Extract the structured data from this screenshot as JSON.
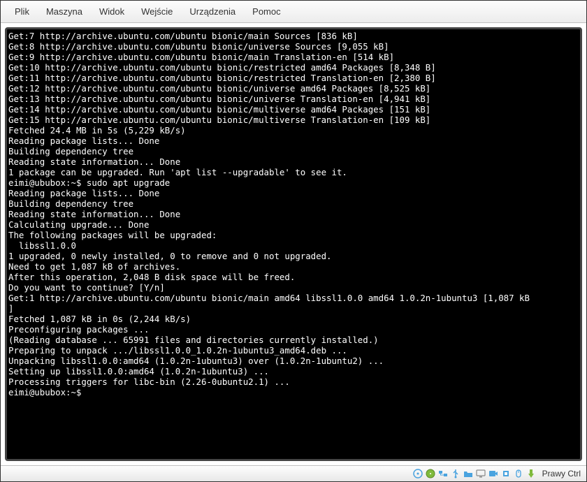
{
  "menubar": {
    "items": [
      "Plik",
      "Maszyna",
      "Widok",
      "Wejście",
      "Urządzenia",
      "Pomoc"
    ]
  },
  "terminal": {
    "lines": [
      "Get:7 http://archive.ubuntu.com/ubuntu bionic/main Sources [836 kB]",
      "Get:8 http://archive.ubuntu.com/ubuntu bionic/universe Sources [9,055 kB]",
      "Get:9 http://archive.ubuntu.com/ubuntu bionic/main Translation-en [514 kB]",
      "Get:10 http://archive.ubuntu.com/ubuntu bionic/restricted amd64 Packages [8,348 B]",
      "Get:11 http://archive.ubuntu.com/ubuntu bionic/restricted Translation-en [2,380 B]",
      "Get:12 http://archive.ubuntu.com/ubuntu bionic/universe amd64 Packages [8,525 kB]",
      "Get:13 http://archive.ubuntu.com/ubuntu bionic/universe Translation-en [4,941 kB]",
      "Get:14 http://archive.ubuntu.com/ubuntu bionic/multiverse amd64 Packages [151 kB]",
      "Get:15 http://archive.ubuntu.com/ubuntu bionic/multiverse Translation-en [109 kB]",
      "Fetched 24.4 MB in 5s (5,229 kB/s)",
      "Reading package lists... Done",
      "Building dependency tree",
      "Reading state information... Done",
      "1 package can be upgraded. Run 'apt list --upgradable' to see it.",
      "eimi@ububox:~$ sudo apt upgrade",
      "Reading package lists... Done",
      "Building dependency tree",
      "Reading state information... Done",
      "Calculating upgrade... Done",
      "The following packages will be upgraded:",
      "  libssl1.0.0",
      "1 upgraded, 0 newly installed, 0 to remove and 0 not upgraded.",
      "Need to get 1,087 kB of archives.",
      "After this operation, 2,048 B disk space will be freed.",
      "Do you want to continue? [Y/n]",
      "Get:1 http://archive.ubuntu.com/ubuntu bionic/main amd64 libssl1.0.0 amd64 1.0.2n-1ubuntu3 [1,087 kB",
      "]",
      "Fetched 1,087 kB in 0s (2,244 kB/s)",
      "Preconfiguring packages ...",
      "(Reading database ... 65991 files and directories currently installed.)",
      "Preparing to unpack .../libssl1.0.0_1.0.2n-1ubuntu3_amd64.deb ...",
      "Unpacking libssl1.0.0:amd64 (1.0.2n-1ubuntu3) over (1.0.2n-1ubuntu2) ...",
      "Setting up libssl1.0.0:amd64 (1.0.2n-1ubuntu3) ...",
      "Processing triggers for libc-bin (2.26-0ubuntu2.1) ...",
      "eimi@ububox:~$ "
    ]
  },
  "statusbar": {
    "icons": [
      "optical-disc-icon",
      "hard-disk-icon",
      "network-icon",
      "usb-icon",
      "shared-folder-icon",
      "display-icon",
      "recording-icon",
      "cpu-icon",
      "mouse-integration-icon",
      "keyboard-icon"
    ],
    "hostkey": "Prawy Ctrl"
  }
}
